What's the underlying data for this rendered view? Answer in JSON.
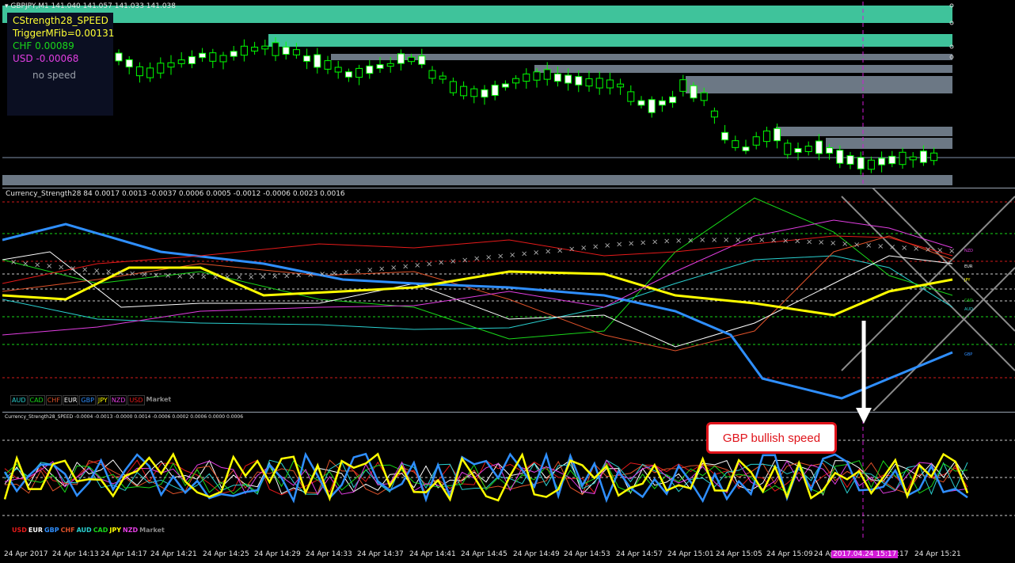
{
  "price_pane": {
    "symbol_header": "GBPJPY,M1  141.040 141.057 141.033 141.038",
    "info": {
      "indicator_name": "CStrength28_SPEED",
      "trigger": "TriggerMFib=0.00131",
      "chf": "CHF 0.00089",
      "usd": "USD -0.00068",
      "speed_status": "no speed"
    },
    "colors": {
      "bull_candle": "#ffffff",
      "bear_candle": "#000000",
      "wick": "#00ff00",
      "zone_green": "#3fc39b",
      "zone_gray": "#6c7885"
    }
  },
  "strength_pane": {
    "header": "Currency_Strength28 84 0.0017 0.0013 -0.0037 0.0006 0.0005 -0.0012 -0.0006 0.0023 0.0016",
    "legend": [
      {
        "label": "AUD",
        "color": "#2ad1d1"
      },
      {
        "label": "CAD",
        "color": "#19d819"
      },
      {
        "label": "CHF",
        "color": "#e0522a"
      },
      {
        "label": "EUR",
        "color": "#ffffff"
      },
      {
        "label": "GBP",
        "color": "#2f8fff"
      },
      {
        "label": "JPY",
        "color": "#ffff00"
      },
      {
        "label": "NZD",
        "color": "#e23ee2"
      },
      {
        "label": "USD",
        "color": "#e61a1a"
      }
    ],
    "legend_market": "Market",
    "right_labels": [
      "NZD",
      "EUR",
      "JPY",
      "CAD",
      "AUD",
      "GBP"
    ]
  },
  "speed_pane": {
    "header": "Currency_Strength28_SPEED  -0.0004 -0.0013 -0.0000 0.0014 -0.0006 0.0002 0.0006 0.0000 0.0006",
    "legend": [
      {
        "label": "USD",
        "color": "#e61a1a"
      },
      {
        "label": "EUR",
        "color": "#ffffff"
      },
      {
        "label": "GBP",
        "color": "#2f8fff"
      },
      {
        "label": "CHF",
        "color": "#e0522a"
      },
      {
        "label": "AUD",
        "color": "#2ad1d1"
      },
      {
        "label": "CAD",
        "color": "#19d819"
      },
      {
        "label": "JPY",
        "color": "#ffff00"
      },
      {
        "label": "NZD",
        "color": "#e23ee2"
      }
    ],
    "legend_market": "Market",
    "callout": "GBP bullish speed"
  },
  "time_axis": {
    "labels": [
      "24 Apr 2017",
      "24 Apr 14:13",
      "24 Apr 14:17",
      "24 Apr 14:21",
      "24 Apr 14:25",
      "24 Apr 14:29",
      "24 Apr 14:33",
      "24 Apr 14:37",
      "24 Apr 14:41",
      "24 Apr 14:45",
      "24 Apr 14:49",
      "24 Apr 14:53",
      "24 Apr 14:57",
      "24 Apr 15:01",
      "24 Apr 15:05",
      "24 Apr 15:09",
      "24 Apr 15:13",
      "24 Apr 15:21"
    ],
    "cursor_time": "2017.04.24 15:17",
    "cursor_suffix": ":17"
  }
}
